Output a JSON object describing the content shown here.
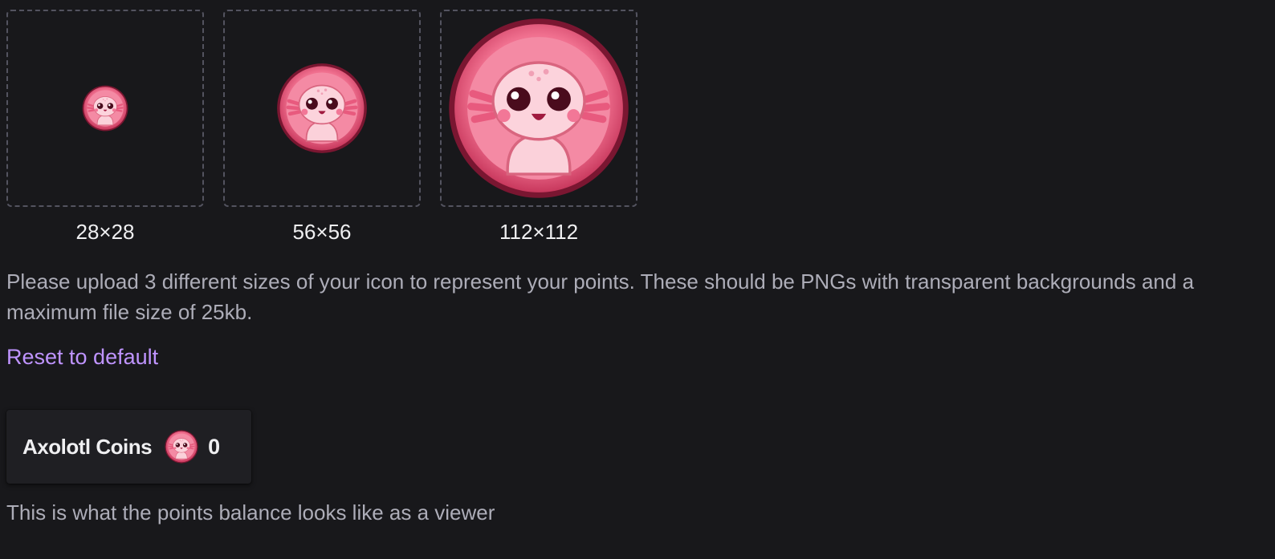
{
  "icons": [
    {
      "size_label": "28×28"
    },
    {
      "size_label": "56×56"
    },
    {
      "size_label": "112×112"
    }
  ],
  "description": "Please upload 3 different sizes of your icon to represent your points. These should be PNGs with transparent backgrounds and a maximum file size of 25kb.",
  "reset_link": "Reset to default",
  "balance_preview": {
    "name": "Axolotl Coins",
    "value": "0",
    "icon": "axolotl-coin-icon"
  },
  "viewer_note": "This is what the points balance looks like as a viewer",
  "colors": {
    "background": "#18181b",
    "link": "#bf94ff",
    "coin_pink": "#f0708f",
    "muted_text": "#adadb8"
  }
}
